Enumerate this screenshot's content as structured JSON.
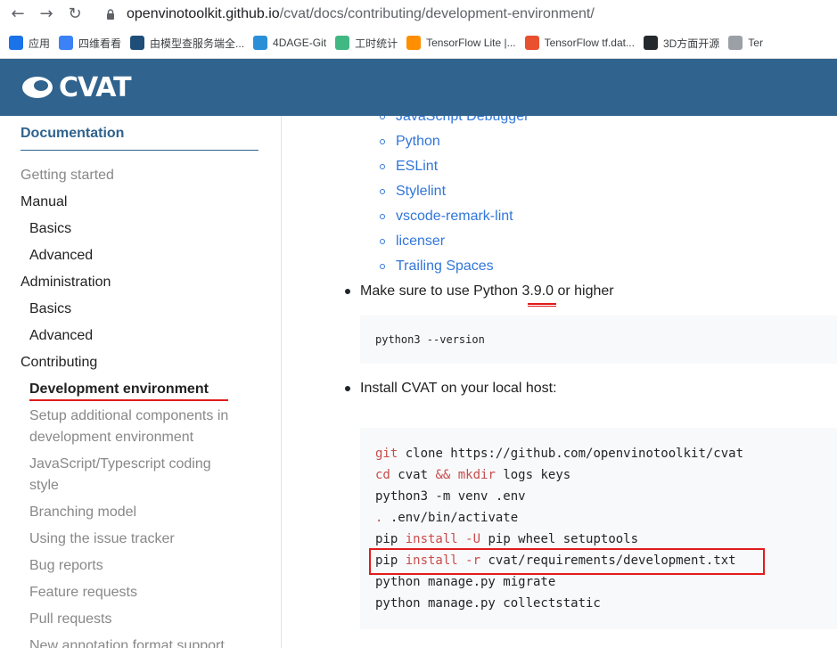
{
  "browser": {
    "url_host": "openvinotoolkit.github.io",
    "url_path": "/cvat/docs/contributing/development-environment/",
    "bookmarks": [
      {
        "icon": "apps-grid-icon",
        "label": "应用",
        "color": "#1a73e8"
      },
      {
        "icon": "bookmark-blue-icon",
        "label": "四维看看",
        "color": "#3b82f6"
      },
      {
        "icon": "bookmark-s-icon",
        "label": "由模型查服务端全...",
        "color": "#1f4e79"
      },
      {
        "icon": "bookmark-4dage-icon",
        "label": "4DAGE-Git",
        "color": "#2b8fd8"
      },
      {
        "icon": "vue-icon",
        "label": "工时统计",
        "color": "#41b883"
      },
      {
        "icon": "tensorflow-icon",
        "label": "TensorFlow Lite |...",
        "color": "#ff8f00"
      },
      {
        "icon": "bookmark-c-icon",
        "label": "TensorFlow tf.dat...",
        "color": "#e8502f"
      },
      {
        "icon": "github-icon",
        "label": "3D方面开源",
        "color": "#24292e"
      },
      {
        "icon": "bookmark-doc-icon",
        "label": "Ter",
        "color": "#9aa0a6"
      }
    ]
  },
  "site": {
    "logo_text": "CVAT",
    "header_color": "#30638e"
  },
  "sidebar": {
    "title": "Documentation",
    "items": [
      {
        "label": "Getting started",
        "level": 0,
        "style": "muted"
      },
      {
        "label": "Manual",
        "level": 0,
        "style": "dark"
      },
      {
        "label": "Basics",
        "level": 1,
        "style": "dark"
      },
      {
        "label": "Advanced",
        "level": 1,
        "style": "dark"
      },
      {
        "label": "Administration",
        "level": 0,
        "style": "dark"
      },
      {
        "label": "Basics",
        "level": 1,
        "style": "dark"
      },
      {
        "label": "Advanced",
        "level": 1,
        "style": "dark"
      },
      {
        "label": "Contributing",
        "level": 0,
        "style": "dark"
      },
      {
        "label": "Development environment",
        "level": 1,
        "style": "active"
      },
      {
        "label": "Setup additional components in",
        "level": 1,
        "style": "muted"
      },
      {
        "label": "development environment",
        "level": 1,
        "style": "muted"
      },
      {
        "label": "JavaScript/Typescript coding",
        "level": 1,
        "style": "muted"
      },
      {
        "label": "style",
        "level": 1,
        "style": "muted"
      },
      {
        "label": "Branching model",
        "level": 1,
        "style": "muted"
      },
      {
        "label": "Using the issue tracker",
        "level": 1,
        "style": "muted"
      },
      {
        "label": "Bug reports",
        "level": 1,
        "style": "muted"
      },
      {
        "label": "Feature requests",
        "level": 1,
        "style": "muted"
      },
      {
        "label": "Pull requests",
        "level": 1,
        "style": "muted"
      },
      {
        "label": "New annotation format support",
        "level": 1,
        "style": "muted"
      }
    ]
  },
  "main": {
    "extensions": [
      "JavaScript Debugger",
      "Python",
      "ESLint",
      "Stylelint",
      "vscode-remark-lint",
      "licenser",
      "Trailing Spaces"
    ],
    "python_note_prefix": "Make sure to use Python ",
    "python_version": "3.9.0",
    "python_note_suffix": " or higher",
    "version_cmd": "python3 --version",
    "install_note": "Install CVAT on your local host:",
    "install_code": [
      [
        {
          "t": "git",
          "k": true
        },
        {
          "t": " clone https://github.com/openvinotoolkit/cvat",
          "k": false
        }
      ],
      [
        {
          "t": "cd",
          "k": true
        },
        {
          "t": " cvat ",
          "k": false
        },
        {
          "t": "&&",
          "k": true
        },
        {
          "t": " ",
          "k": false
        },
        {
          "t": "mkdir",
          "k": true
        },
        {
          "t": " logs keys",
          "k": false
        }
      ],
      [
        {
          "t": "python3 -m venv .env",
          "k": false
        }
      ],
      [
        {
          "t": ".",
          "k": true
        },
        {
          "t": " .env/bin/activate",
          "k": false
        }
      ],
      [
        {
          "t": "pip ",
          "k": false
        },
        {
          "t": "install",
          "k": true
        },
        {
          "t": " ",
          "k": false
        },
        {
          "t": "-U",
          "k": true
        },
        {
          "t": " pip wheel setuptools",
          "k": false
        }
      ],
      [
        {
          "t": "pip ",
          "k": false
        },
        {
          "t": "install",
          "k": true
        },
        {
          "t": " ",
          "k": false
        },
        {
          "t": "-r",
          "k": true
        },
        {
          "t": " cvat/requirements/development.txt",
          "k": false
        }
      ],
      [
        {
          "t": "python manage.py migrate",
          "k": false
        }
      ],
      [
        {
          "t": "python manage.py collectstatic",
          "k": false
        }
      ]
    ],
    "link_color": "#3176d9",
    "keyword_color": "#c94c4c",
    "annotation_color": "#e01b1b"
  }
}
